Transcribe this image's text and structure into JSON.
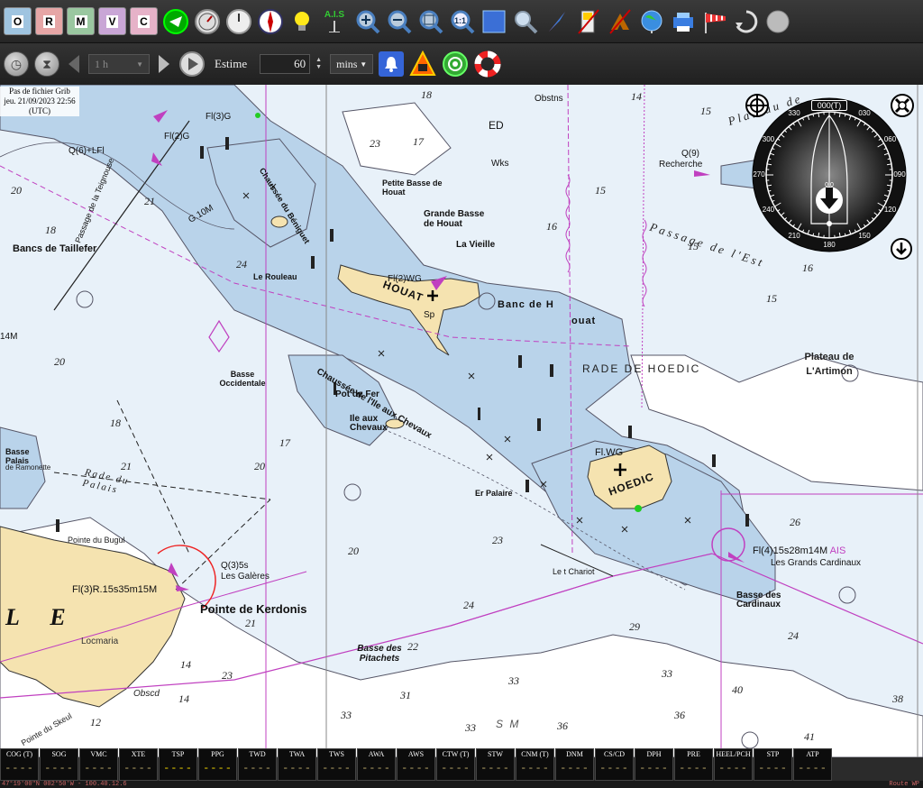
{
  "toolbar": {
    "chart_buttons": [
      {
        "label": "O",
        "color": "#9fc4e0"
      },
      {
        "label": "R",
        "color": "#e6a6a6"
      },
      {
        "label": "M",
        "color": "#9ac7a0"
      },
      {
        "label": "V",
        "color": "#c9a6d6"
      },
      {
        "label": "C",
        "color": "#e6b2c8"
      }
    ],
    "ais_label": "A.I.S"
  },
  "toolbar2": {
    "interval_value": "1 h",
    "estime_label": "Estime",
    "estime_value": "60",
    "unit_value": "mins"
  },
  "grib": {
    "line1": "Pas de fichier Grib",
    "line2": "jeu. 21/09/2023 22:56",
    "line3": "(UTC)"
  },
  "compass": {
    "heading_readout": "000(T)",
    "speed_readout": "0.0",
    "degrees": [
      "000(T)",
      "030",
      "060",
      "090",
      "120",
      "150",
      "180",
      "210",
      "240",
      "270",
      "300",
      "330"
    ]
  },
  "chart_labels": {
    "houat": "HOUAT",
    "hoedic": "HOEDIC",
    "kerdonis": "Pointe de Kerdonis",
    "rade_hoedic": "RADE DE HOEDIC",
    "passage_est": "Passage de l'Est",
    "plateau_artimon": "Plateau de L'Artimon",
    "cardinaux_light": "Fl(4)15s28m14M",
    "cardinaux_ais": "AIS",
    "grands_cardinaux": "Les Grands Cardinaux",
    "basse_cardinaux": "Basse des Cardinaux",
    "bancs_taillefer": "Bancs de Taillefer",
    "chaussee_chevaux": "Chaussée de l'Ile aux Chevaux",
    "ile_chevaux": "Ile aux Chevaux",
    "rade_palais": "Rade du Palais",
    "banc_h": "Banc de H",
    "ouat": "ouat",
    "la_vieille": "La Vieille",
    "petite_basse": "Petite Basse de Houat",
    "grande_basse": "Grande Basse de Houat",
    "le_rouleau": "Le Rouleau",
    "pot_de_fer": "Pot de Fer",
    "basse_occidentale": "Basse Occidentale",
    "basse_pitachets": "Basse des Pitachets",
    "les_galeres": "Les Galères",
    "locmaria": "Locmaria",
    "er_palaire": "Er Palaire",
    "le_chariot": "Le t Chariot",
    "kerdonis_light": "Fl(3)R.15s35m15M",
    "galeres_light": "Q(3)5s",
    "recherche": "Recherche",
    "pointe_bugul": "Pointe du Bugul",
    "pointe_skeul": "Pointe du Skeul",
    "obscd": "Obscd",
    "basse_palais": "Basse Palais",
    "ramonette": "de Ramonette",
    "big_le": "L E",
    "fl_wg": "Fl.WG",
    "fl2_wg": "Fl(2)WG",
    "fl3g": "Fl(3)G",
    "fl2g": "Fl(2)G",
    "q6lfl": "Q(6)+LFl",
    "q9": "Q(9)",
    "chaussee_beniguet": "Chaussée du Béniguet",
    "passage_teignouse": "Passage de la Teignouse",
    "plateau_top": "Plateau de",
    "obstns": "Obstns",
    "wks": "Wks",
    "ed": "ED",
    "g10m": "G.10M",
    "14m": "14M",
    "sp": "Sp",
    "sm": "S M"
  },
  "instruments": [
    {
      "label": "COG (T)",
      "value": "----"
    },
    {
      "label": "SOG",
      "value": "----"
    },
    {
      "label": "VMC",
      "value": "----"
    },
    {
      "label": "XTE",
      "value": "----"
    },
    {
      "label": "TSP",
      "value": "----",
      "hot": true
    },
    {
      "label": "PPG",
      "value": "----",
      "hot": true
    },
    {
      "label": "TWD",
      "value": "----"
    },
    {
      "label": "TWA",
      "value": "----"
    },
    {
      "label": "TWS",
      "value": "----"
    },
    {
      "label": "AWA",
      "value": "----"
    },
    {
      "label": "AWS",
      "value": "----"
    },
    {
      "label": "CTW (T)",
      "value": "----"
    },
    {
      "label": "STW",
      "value": "----"
    },
    {
      "label": "CNM (T)",
      "value": "----"
    },
    {
      "label": "DNM",
      "value": "----"
    },
    {
      "label": "CS/CD",
      "value": "----"
    },
    {
      "label": "DPH",
      "value": "----"
    },
    {
      "label": "PRE",
      "value": "----"
    },
    {
      "label": "HEEL/PCH",
      "value": "----"
    },
    {
      "label": "STP",
      "value": "----"
    },
    {
      "label": "ATP",
      "value": "----"
    }
  ],
  "status": {
    "left": "47°19'00\"N 002°50'W - 100.40.12.6",
    "right": "Route WP"
  },
  "colors": {
    "shallow": "#b9d3ea",
    "land": "#f5e3b0",
    "deep": "#e8f1f9",
    "magenta": "#c040c0"
  }
}
